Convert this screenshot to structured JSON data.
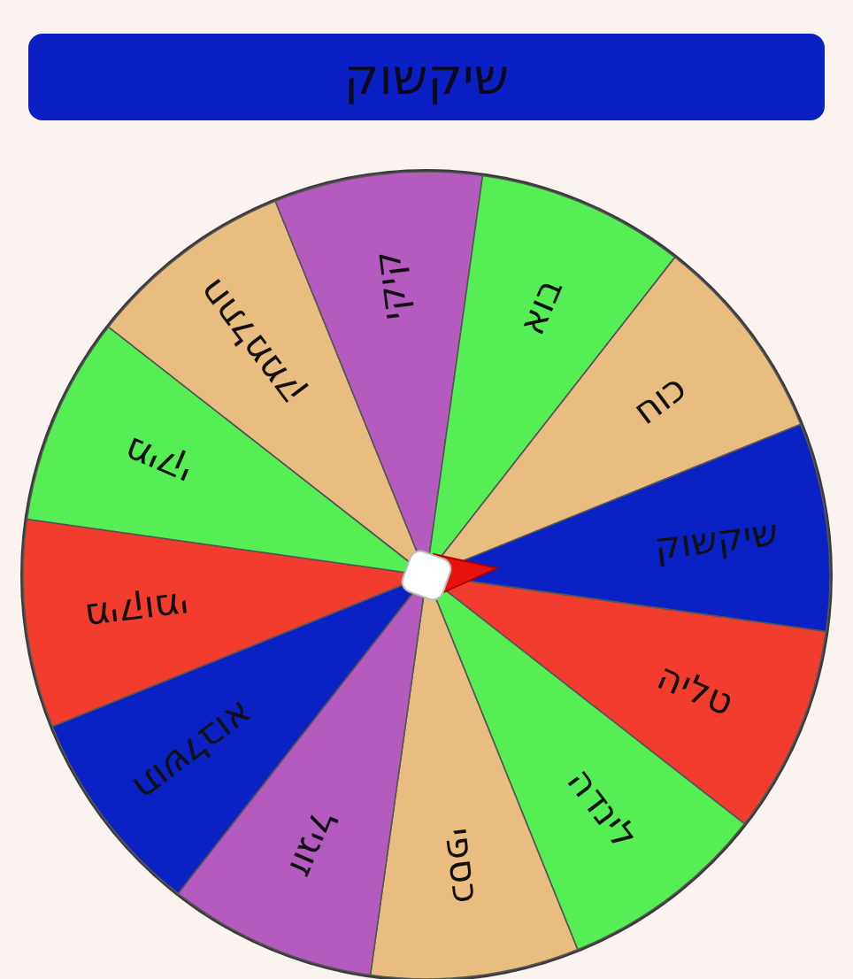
{
  "header": {
    "text": "שיקשוק"
  },
  "wheel": {
    "segments": [
      {
        "label": "שיקשוק",
        "color": "#0a22c4"
      },
      {
        "label": "טליה",
        "color": "#f23d2e"
      },
      {
        "label": "לינדה",
        "color": "#55ee55"
      },
      {
        "label": "כספי",
        "color": "#e9bd80"
      },
      {
        "label": "זוגיל",
        "color": "#b55bc0"
      },
      {
        "label": "תושלבוא",
        "color": "#0a22c4"
      },
      {
        "label": "מיקומי",
        "color": "#f23d2e"
      },
      {
        "label": "מיקי",
        "color": "#55ee55"
      },
      {
        "label": "חתלממק",
        "color": "#e9bd80"
      },
      {
        "label": "קיקי",
        "color": "#b55bc0"
      },
      {
        "label": "בוא",
        "color": "#55ee55"
      },
      {
        "label": "כוח",
        "color": "#e9bd80"
      }
    ]
  }
}
